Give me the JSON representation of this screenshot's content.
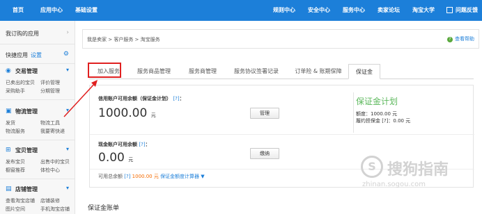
{
  "topnav": {
    "left": [
      "首页",
      "应用中心",
      "基础设置"
    ],
    "right": [
      "规则中心",
      "安全中心",
      "服务中心",
      "卖家论坛",
      "淘宝大学",
      "问题反馈"
    ]
  },
  "sidebar": {
    "my_apps": "我订购的应用",
    "quick_apps": "快捷应用",
    "quick_settings": "设置",
    "groups": [
      {
        "title": "交易管理",
        "links": [
          "已卖出的宝贝",
          "评价管理",
          "采购助手",
          "分期管理"
        ]
      },
      {
        "title": "物流管理",
        "links": [
          "发货",
          "物流工具",
          "物流服务",
          "我要寄快递"
        ]
      },
      {
        "title": "宝贝管理",
        "links": [
          "发布宝贝",
          "出售中的宝贝",
          "橱窗推荐",
          "体检中心"
        ]
      },
      {
        "title": "店铺管理",
        "links": [
          "查看淘宝店铺",
          "店铺装修",
          "图片空间",
          "手机淘宝店铺"
        ]
      }
    ]
  },
  "breadcrumb": {
    "path": "我是卖家 > 客户服务 > 淘宝服务",
    "help": "查看帮助"
  },
  "tabs": [
    "加入服务",
    "服务商品管理",
    "服务商管理",
    "服务协议签署记录",
    "订单险 & 账期保障",
    "保证金"
  ],
  "credit": {
    "label": "信用账户可用余额（保证金计划）",
    "q": "[?]",
    "amount": "1000.00",
    "unit": "元",
    "button": "管理",
    "brand": "保证金计划",
    "quota": "额度：1000.00 元",
    "used": "履约担保金 [?]：0.00 元"
  },
  "cash": {
    "label": "现金账户可用余额",
    "q": "[?]",
    "amount": "0.00",
    "unit": "元",
    "button": "缴纳"
  },
  "available": {
    "prefix": "可用总余额",
    "q": "[?]",
    "amount": "1000.00 元",
    "calc": "保证金额度计算器 ▼"
  },
  "ledger_title": "保证金账单",
  "watermark": {
    "text": "搜狗指南",
    "url": "zhinan.sogou.com"
  },
  "colors": {
    "topbar": "#1c7fd9",
    "accent": "#1c7fd9",
    "highlight": "#e02020",
    "brand": "#5cb85c",
    "amount": "#f56b00"
  }
}
